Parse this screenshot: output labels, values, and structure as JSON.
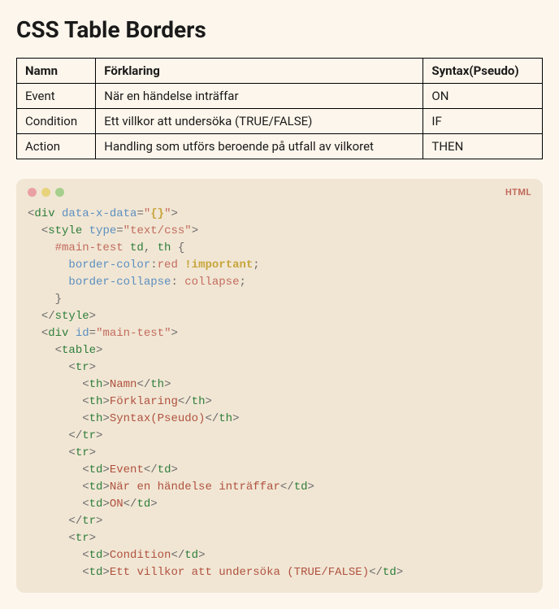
{
  "heading": "CSS Table Borders",
  "table": {
    "headers": [
      "Namn",
      "Förklaring",
      "Syntax(Pseudo)"
    ],
    "rows": [
      [
        "Event",
        "När en händelse inträffar",
        "ON"
      ],
      [
        "Condition",
        "Ett villkor att undersöka (TRUE/FALSE)",
        "IF"
      ],
      [
        "Action",
        "Handling som utförs beroende på utfall av vilkoret",
        "THEN"
      ]
    ]
  },
  "codeblock": {
    "language": "HTML",
    "dots": [
      "red",
      "yellow",
      "green"
    ],
    "code": {
      "attr_data": "data-x-data",
      "attr_data_val": "{}",
      "style_type_attr": "type",
      "style_type_val": "text/css",
      "css_selector_id": "#main-test",
      "css_sel_td": "td",
      "css_sel_th": "th",
      "css_prop1": "border-color",
      "css_val1": "red",
      "css_imp": "!important",
      "css_prop2": "border-collapse",
      "css_val2": "collapse",
      "div_id_attr": "id",
      "div_id_val": "main-test",
      "th1": "Namn",
      "th2": "Förklaring",
      "th3": "Syntax(Pseudo)",
      "r1c1": "Event",
      "r1c2": "När en händelse inträffar",
      "r1c3": "ON",
      "r2c1": "Condition",
      "r2c2": "Ett villkor att undersöka (TRUE/FALSE)"
    }
  }
}
